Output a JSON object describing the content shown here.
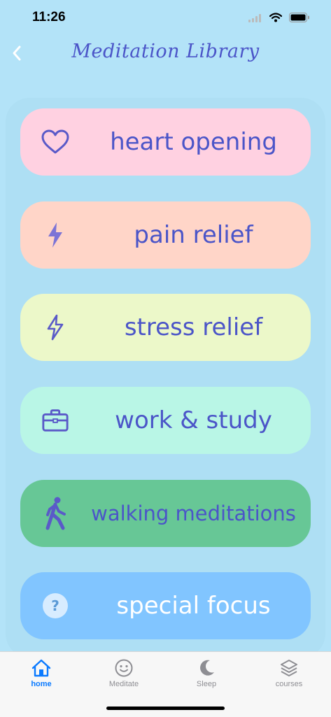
{
  "status_bar": {
    "time": "11:26"
  },
  "nav": {
    "title": "Meditation Library",
    "back_icon": "chevron-left-icon"
  },
  "categories": [
    {
      "label": "heart opening",
      "icon": "heart-icon",
      "color": "#ffd1e1"
    },
    {
      "label": "pain relief",
      "icon": "lightning-icon",
      "color": "#ffd5c8"
    },
    {
      "label": "stress relief",
      "icon": "lightning-outline-icon",
      "color": "#ecf8c9"
    },
    {
      "label": "work & study",
      "icon": "briefcase-icon",
      "color": "#b9f6e6"
    },
    {
      "label": "walking meditations",
      "icon": "walking-icon",
      "color": "#67c796"
    },
    {
      "label": "special focus",
      "icon": "question-icon",
      "color": "#81c5ff"
    }
  ],
  "tabs": [
    {
      "label": "home",
      "icon": "home-icon",
      "active": true
    },
    {
      "label": "Meditate",
      "icon": "smiley-icon",
      "active": false
    },
    {
      "label": "Sleep",
      "icon": "moon-icon",
      "active": false
    },
    {
      "label": "courses",
      "icon": "layers-icon",
      "active": false
    }
  ],
  "colors": {
    "accent": "#4b55c8",
    "background": "#b3e3f8",
    "tab_active": "#0a7aff"
  }
}
